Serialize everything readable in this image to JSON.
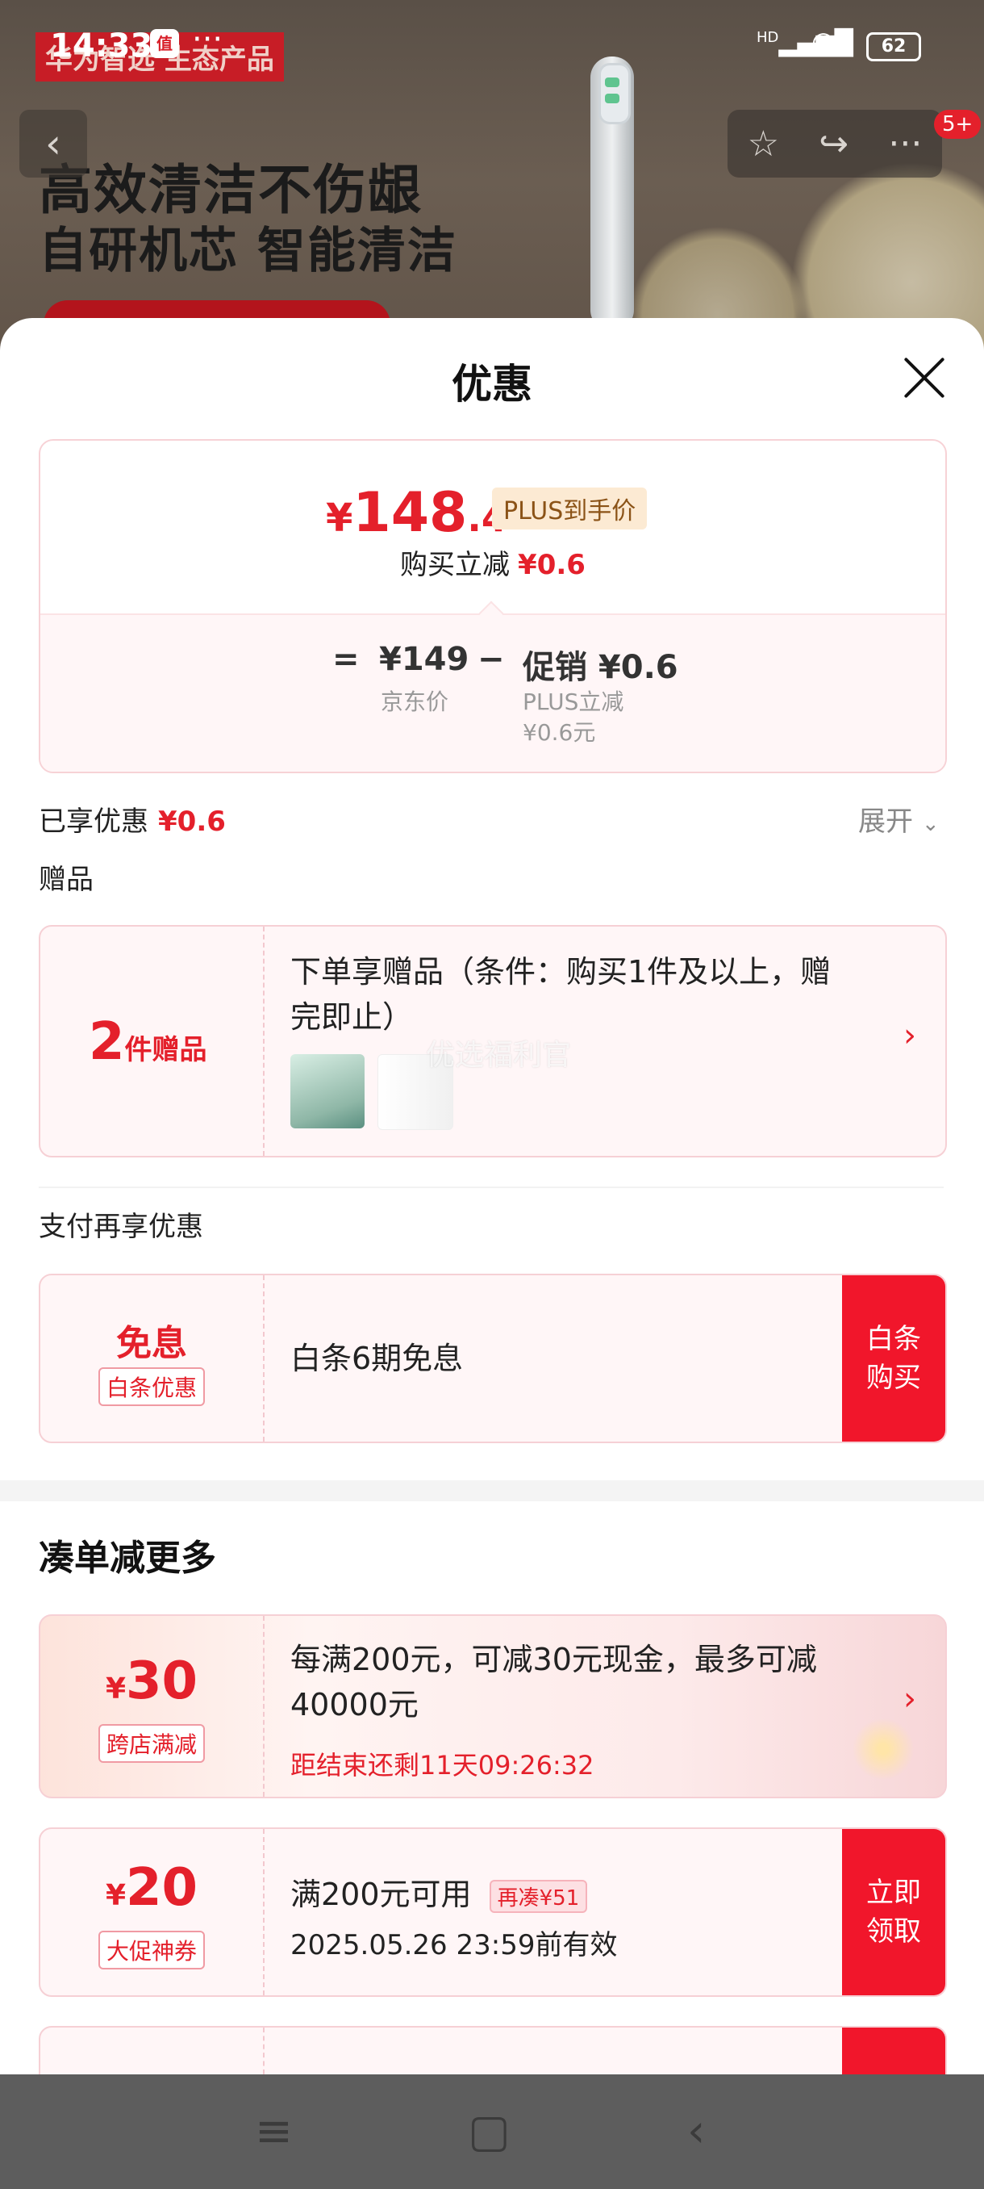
{
  "status_bar": {
    "time": "14:33",
    "app_icon": "值",
    "more": "···",
    "network": "HD",
    "battery": "62"
  },
  "background": {
    "brand": "华为智选 生态产品",
    "headline1": "高效清洁不伤龈",
    "headline2": "自研机芯 智能清洁",
    "badge": "5+"
  },
  "sheet": {
    "title": "优惠",
    "price": {
      "yen": "¥",
      "int": "148",
      "dec": ".4",
      "tag": "PLUS到手价"
    },
    "buy_cut": {
      "label": "购买立减",
      "value": "¥0.6"
    },
    "formula": {
      "eq": "=",
      "jd_price": "¥149",
      "jd_label": "京东价",
      "minus": "−",
      "promo": "促销 ¥0.6",
      "promo_sub1": "PLUS立减",
      "promo_sub2": "¥0.6元"
    },
    "applied": {
      "label": "已享优惠",
      "value": "¥0.6",
      "expand": "展开"
    },
    "gift_section": "赠品",
    "gift": {
      "count": "2",
      "count_unit": "件赠品",
      "desc": "下单享赠品（条件：购买1件及以上，赠完即止）",
      "watermark": "优选福利官"
    },
    "pay_section": "支付再享优惠",
    "baitiao": {
      "main": "免息",
      "tag": "白条优惠",
      "desc": "白条6期免息",
      "button": "白条购买"
    },
    "collect_title": "凑单减更多",
    "cross_store": {
      "yen": "¥",
      "amount": "30",
      "tag": "跨店满减",
      "desc": "每满200元，可减30元现金，最多可减40000元",
      "countdown": "距结束还剩11天09:26:32"
    },
    "promo_coupon": {
      "yen": "¥",
      "amount": "20",
      "tag": "大促神券",
      "desc": "满200元可用",
      "need": "再凑¥51",
      "validity": "2025.05.26 23:59前有效",
      "button": "立即领取"
    }
  },
  "colors": {
    "accent": "#e4202b",
    "button_red": "#f1162b",
    "card_bg": "#fff6f7",
    "plus_tag_bg": "#fcead3"
  }
}
